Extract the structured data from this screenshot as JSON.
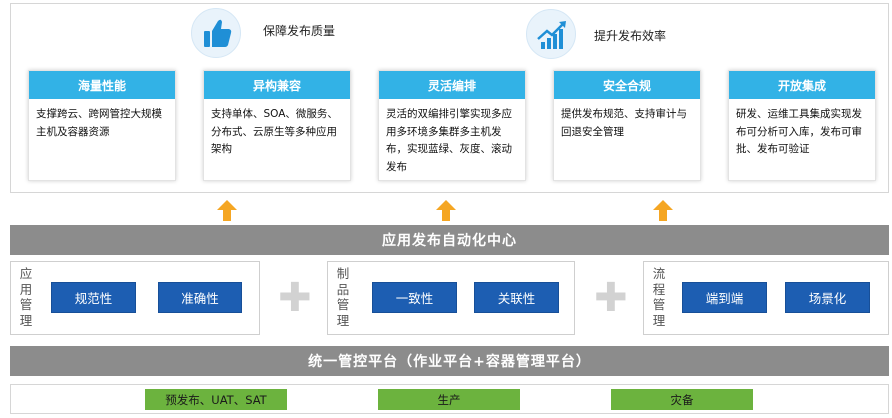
{
  "goals": [
    {
      "label": "保障发布质量",
      "icon": "thumbs-up-icon"
    },
    {
      "label": "提升发布效率",
      "icon": "growth-chart-icon"
    }
  ],
  "cards": [
    {
      "title": "海量性能",
      "body": "支撑跨云、跨网管控大规模主机及容器资源"
    },
    {
      "title": "异构兼容",
      "body": "支持单体、SOA、微服务、分布式、云原生等多种应用架构"
    },
    {
      "title": "灵活编排",
      "body": "灵活的双编排引擎实现多应用多环境多集群多主机发布，实现蓝绿、灰度、滚动发布"
    },
    {
      "title": "安全合规",
      "body": "提供发布规范、支持审计与回退安全管理"
    },
    {
      "title": "开放集成",
      "body": "研发、运维工具集成实现发布可分析可入库，发布可审批、发布可验证"
    }
  ],
  "center_bar": "应用发布自动化中心",
  "groups": [
    {
      "label": "应用管理",
      "items": [
        "规范性",
        "准确性"
      ]
    },
    {
      "label": "制品管理",
      "items": [
        "一致性",
        "关联性"
      ]
    },
    {
      "label": "流程管理",
      "items": [
        "端到端",
        "场景化"
      ]
    }
  ],
  "platform_bar": "统一管控平台（作业平台+容器管理平台）",
  "environments": [
    "预发布、UAT、SAT",
    "生产",
    "灾备"
  ],
  "colors": {
    "card_header": "#32b2e6",
    "blue_button": "#1d5eb2",
    "bar": "#8c8c8c",
    "arrow": "#f5a623",
    "env_button": "#6cb33e"
  }
}
